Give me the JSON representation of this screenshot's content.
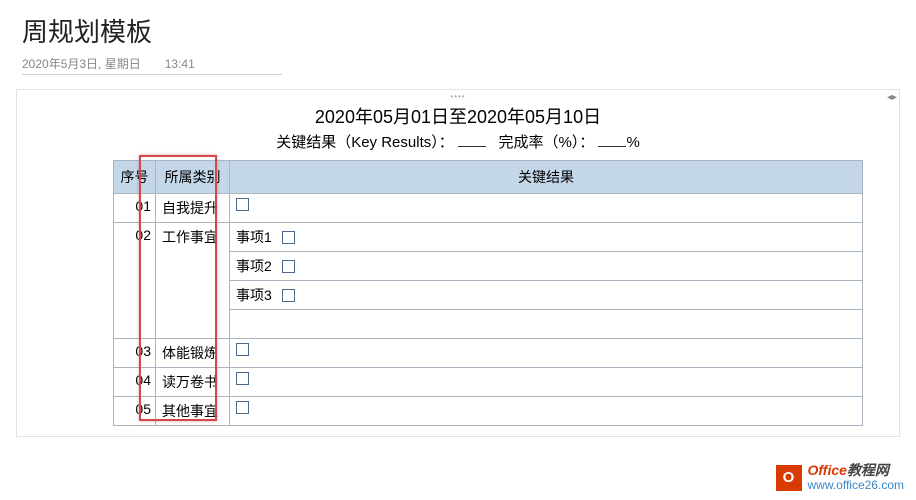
{
  "header": {
    "title": "周规划模板",
    "date": "2020年5月3日, 星期日",
    "time": "13:41"
  },
  "panel": {
    "date_range": "2020年05月01日至2020年05月10日",
    "kr_label": "关键结果（Key Results）：",
    "completion_label": "完成率（%）：",
    "completion_suffix": "%"
  },
  "table": {
    "headers": {
      "index": "序号",
      "category": "所属类别",
      "result": "关键结果"
    },
    "rows": [
      {
        "idx": "01",
        "category": "自我提升",
        "items": []
      },
      {
        "idx": "02",
        "category": "工作事宜",
        "items": [
          "事项1",
          "事项2",
          "事项3"
        ]
      },
      {
        "idx": "03",
        "category": "体能锻炼",
        "items": []
      },
      {
        "idx": "04",
        "category": "读万卷书",
        "items": []
      },
      {
        "idx": "05",
        "category": "其他事宜",
        "items": []
      }
    ]
  },
  "watermark": {
    "brand": "Office",
    "rest": "教程网",
    "url": "www.office26.com"
  }
}
